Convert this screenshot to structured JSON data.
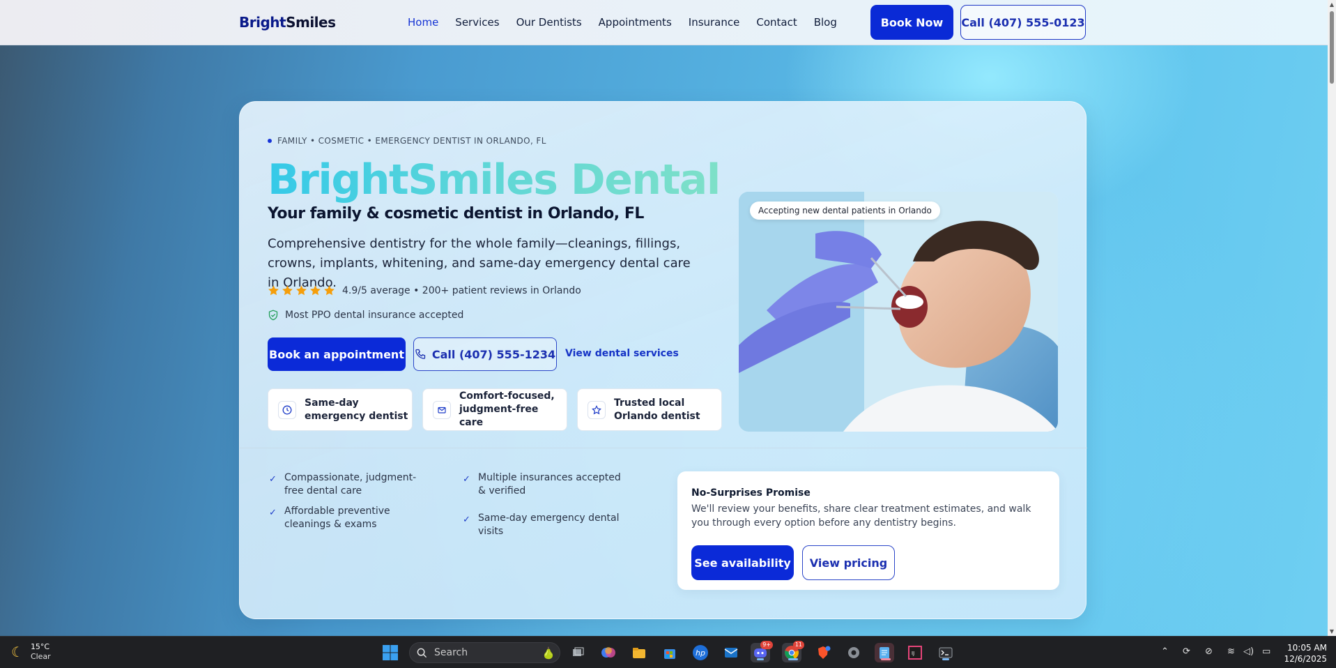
{
  "header": {
    "brand_part1": "Bright",
    "brand_part2": "Smiles",
    "nav": [
      "Home",
      "Services",
      "Our Dentists",
      "Appointments",
      "Insurance",
      "Contact",
      "Blog"
    ],
    "active_nav": "Home",
    "book_now_label": "Book Now",
    "call_label": "Call (407) 555-0123"
  },
  "hero": {
    "eyebrow": "FAMILY • COSMETIC • EMERGENCY DENTIST IN ORLANDO, FL",
    "title": "BrightSmiles Dental",
    "subtitle": "Your family & cosmetic dentist in Orlando, FL",
    "lead": "Comprehensive dentistry for the whole family—cleanings, fillings, crowns, implants, whitening, and same-day emergency dental care in Orlando.",
    "rating_stars": 5,
    "rating_text": "4.9/5 average • 200+ patient reviews in Orlando",
    "insurance_text": "Most PPO dental insurance accepted",
    "book_button": "Book an appointment",
    "call_button": "Call (407) 555-1234",
    "services_link": "View dental services",
    "features": [
      {
        "icon": "clock-icon",
        "label": "Same-day emergency dentist"
      },
      {
        "icon": "mail-icon",
        "label": "Comfort-focused, judgment-free care"
      },
      {
        "icon": "star-icon",
        "label": "Trusted local Orlando dentist"
      }
    ],
    "photo_badge": "Accepting new dental patients in Orlando",
    "checklist": [
      "Compassionate, judgment-free dental care",
      "Multiple insurances accepted & verified",
      "Affordable preventive cleanings & exams",
      "Same-day emergency dental visits"
    ],
    "promise": {
      "title": "No-Surprises Promise",
      "body": "We'll review your benefits, share clear treatment estimates, and walk you through every option before any dentistry begins.",
      "availability_button": "See availability",
      "pricing_button": "View pricing"
    }
  },
  "colors": {
    "primary": "#0b2ad8",
    "brand_dark": "#0a1a8a",
    "title_gradient_start": "#35c9e8",
    "title_gradient_end": "#7ee0c8",
    "star": "#f59e0b",
    "shield": "#1f9d55"
  },
  "taskbar": {
    "weather_temp": "15°C",
    "weather_desc": "Clear",
    "search_placeholder": "Search",
    "time": "10:05 AM",
    "date": "12/6/2025",
    "discord_badge": "9+",
    "chrome_badge": "11"
  }
}
